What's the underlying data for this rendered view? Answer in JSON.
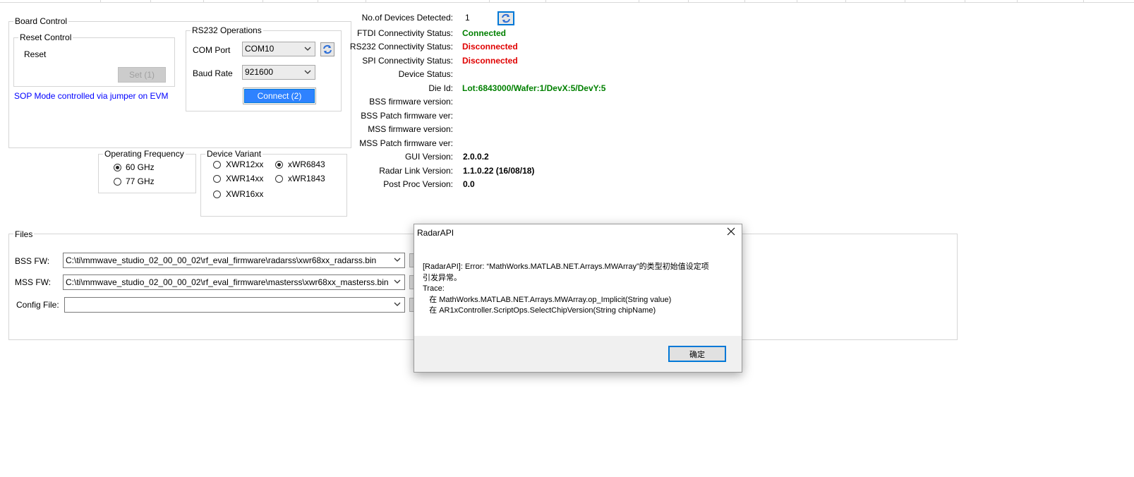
{
  "board_control": {
    "title": "Board Control",
    "reset_control": {
      "title": "Reset Control",
      "reset_label": "Reset",
      "set_button": "Set (1)"
    },
    "sop_note": "SOP Mode controlled via jumper on EVM",
    "rs232": {
      "title": "RS232 Operations",
      "com_port_label": "COM Port",
      "com_port_value": "COM10",
      "baud_rate_label": "Baud Rate",
      "baud_rate_value": "921600",
      "connect_button": "Connect (2)"
    }
  },
  "operating_frequency": {
    "title": "Operating Frequency",
    "options": [
      {
        "label": "60 GHz",
        "selected": true
      },
      {
        "label": "77 GHz",
        "selected": false
      }
    ]
  },
  "device_variant": {
    "title": "Device Variant",
    "options": [
      {
        "label": "XWR12xx",
        "selected": false
      },
      {
        "label": "xWR6843",
        "selected": true
      },
      {
        "label": "XWR14xx",
        "selected": false
      },
      {
        "label": "xWR1843",
        "selected": false
      },
      {
        "label": "XWR16xx",
        "selected": false
      }
    ]
  },
  "status": {
    "devices_label": "No.of Devices Detected:",
    "devices_value": "1",
    "ftdi_label": "FTDI Connectivity Status:",
    "ftdi_value": "Connected",
    "rs232_label": "RS232 Connectivity Status:",
    "rs232_value": "Disconnected",
    "spi_label": "SPI Connectivity Status:",
    "spi_value": "Disconnected",
    "device_status_label": "Device Status:",
    "die_id_label": "Die Id:",
    "die_id_value": "Lot:6843000/Wafer:1/DevX:5/DevY:5",
    "bss_fw_label": "BSS firmware version:",
    "bss_patch_label": "BSS Patch firmware ver:",
    "mss_fw_label": "MSS firmware version:",
    "mss_patch_label": "MSS Patch firmware ver:",
    "gui_label": "GUI Version:",
    "gui_value": "2.0.0.2",
    "radarlink_label": "Radar Link Version:",
    "radarlink_value": "1.1.0.22 (16/08/18)",
    "postproc_label": "Post Proc Version:",
    "postproc_value": "0.0"
  },
  "files": {
    "title": "Files",
    "bss_label": "BSS FW:",
    "bss_value": "C:\\ti\\mmwave_studio_02_00_00_02\\rf_eval_firmware\\radarss\\xwr68xx_radarss.bin",
    "mss_label": "MSS FW:",
    "mss_value": "C:\\ti\\mmwave_studio_02_00_00_02\\rf_eval_firmware\\masterss\\xwr68xx_masterss.bin",
    "config_label": "Config File:",
    "config_value": ""
  },
  "dialog": {
    "title": "RadarAPI",
    "message": "[RadarAPI]: Error: “MathWorks.MATLAB.NET.Arrays.MWArray”的类型初始值设定项\n引发异常。\nTrace:\n   在 MathWorks.MATLAB.NET.Arrays.MWArray.op_Implicit(String value)\n   在 AR1xController.ScriptOps.SelectChipVersion(String chipName)",
    "ok_button": "确定"
  },
  "colors": {
    "connected": "#008000",
    "disconnected": "#e00000",
    "link_blue": "#0000ff",
    "accent": "#0078d7"
  }
}
